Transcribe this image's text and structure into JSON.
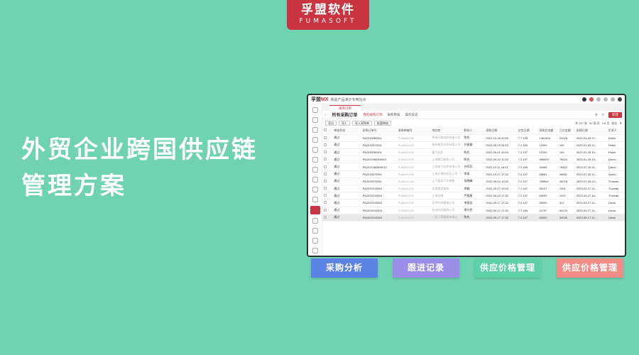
{
  "brand": {
    "name_cn": "孚盟软件",
    "name_en": "FUMASOFT"
  },
  "headline": {
    "line1": "外贸企业跨国供应链",
    "line2": "管理方案"
  },
  "app": {
    "logo_text": "孚盟",
    "logo_accent": "MX",
    "topbar_text": "我是产品演示专用站点",
    "tab_active": "采购订单",
    "page_title": "所有采购订单",
    "nav_items": [
      "我的采购订单",
      "采购审核",
      "操作日志"
    ],
    "add_label": "新建",
    "toolbar": [
      "导出",
      "导入",
      "导入采购单",
      "批量审核"
    ],
    "pager": {
      "total": "共 397 条",
      "page_size": "50 条/页",
      "page": "1/8 页",
      "goto": "前往"
    },
    "columns": [
      "审核状态",
      "采购订单号",
      "采购单编号",
      "供应商",
      "联系人",
      "采购日期",
      "交货日期",
      "采购总金额",
      "已付金额",
      "创建日期",
      "负责人"
    ],
    "rows": [
      [
        "通过",
        "PA2019080001",
        "FUMA20190",
        "德清天和纺织有限公司",
        "陈先",
        "2022-10-28 20:00",
        "7.7.195",
        "1461820",
        "24026",
        "2023-01-28 17:..",
        "Robin"
      ],
      [
        "通过",
        "PA2019070001",
        "FUMA20190",
        "杭州希亚纺织有限公司",
        "孙振雄",
        "2022-09-29 18:13",
        "7.2.180",
        "12000",
        "100",
        "2023-01-09 11:..",
        "Robin"
      ],
      [
        "通过",
        "PA2020050001",
        "FUMA20200",
        "嘉兴纺织",
        "陈先",
        "2022-09-01 20:00",
        "7.2.197",
        "12000",
        "100",
        "2023-01-28 15:..",
        "Robin"
      ],
      [
        "通过",
        "PA2022080000001",
        "FUMA20220",
        "上海朗臣服装公司",
        "陈先",
        "2022-09-22 11:33",
        "7.2.197",
        "986400",
        "78624",
        "2023-01-26 15:..",
        "Quinn"
      ],
      [
        "通过",
        "PA2021080000010",
        "FUMA20210",
        "上海安力纺织有限公司",
        "许同芳",
        "2022-10-11 18:01",
        "7.2.196",
        "33465",
        "78822",
        "2023-07-26 11:..",
        "Quinn"
      ],
      [
        "通过",
        "PA2019070001",
        "FUMA20190",
        "上海文博纺织品公司",
        "李丽",
        "2022-10-17 17:32",
        "7.2.197",
        "46661",
        "46661",
        "2023-07-26 11:..",
        "Quinn"
      ],
      [
        "通过",
        "PA2019070001",
        "FUMA20190",
        "上汽通用汽车销售",
        "张晓峰",
        "2022-09-14 10:52",
        "7.2.197",
        "765992",
        "36078",
        "2023-07-25 13:..",
        "Thomas"
      ],
      [
        "通过",
        "PA2022010004",
        "FUMA20220",
        "丝绸通家服饰",
        "李磊",
        "2022-09-27 10:00",
        "7.2.197",
        "30107",
        "1001",
        "2023-03-27 11:..",
        "Thomas"
      ],
      [
        "通过",
        "PA2022010004",
        "FUMA20220",
        "上海丝绸",
        "严祖星",
        "2022-09-19 17:32",
        "7.2.197",
        "65292",
        "1027",
        "2023-03-27 16:..",
        "Thomas"
      ],
      [
        "通过",
        "PA2022010003",
        "FUMA20220",
        "北京时尚服饰公司",
        "李丽佳",
        "2022-09-17 17:32",
        "7.2.197",
        "30000",
        "412",
        "2023-03-27 11:..",
        "Linda"
      ],
      [
        "通过",
        "PA2022010003",
        "FUMA20220",
        "杭州时尚服饰公司",
        "常兴民",
        "2022-09-17 17:32",
        "7.7.196",
        "11797",
        "94123",
        "2023-03-27 11:..",
        "Linda"
      ],
      [
        "通过",
        "PA2022010003",
        "FUMA20220",
        "广西万家服装有限公",
        "陈先",
        "2022-09-17 17:32",
        "7.2.197",
        "30000",
        "30035",
        "2023-09-17 11:..",
        "Linda"
      ]
    ]
  },
  "features": [
    {
      "label": "采购分析",
      "color": "#5b83e6"
    },
    {
      "label": "跟进记录",
      "color": "#9c8ee8"
    },
    {
      "label": "供应价格管理",
      "color": "#5fcfa7"
    },
    {
      "label": "供应价格管理",
      "color": "#f28c86"
    }
  ],
  "colors": {
    "background": "#6fd2b1",
    "brand": "#c8343f",
    "window_border": "#2b2f33"
  }
}
